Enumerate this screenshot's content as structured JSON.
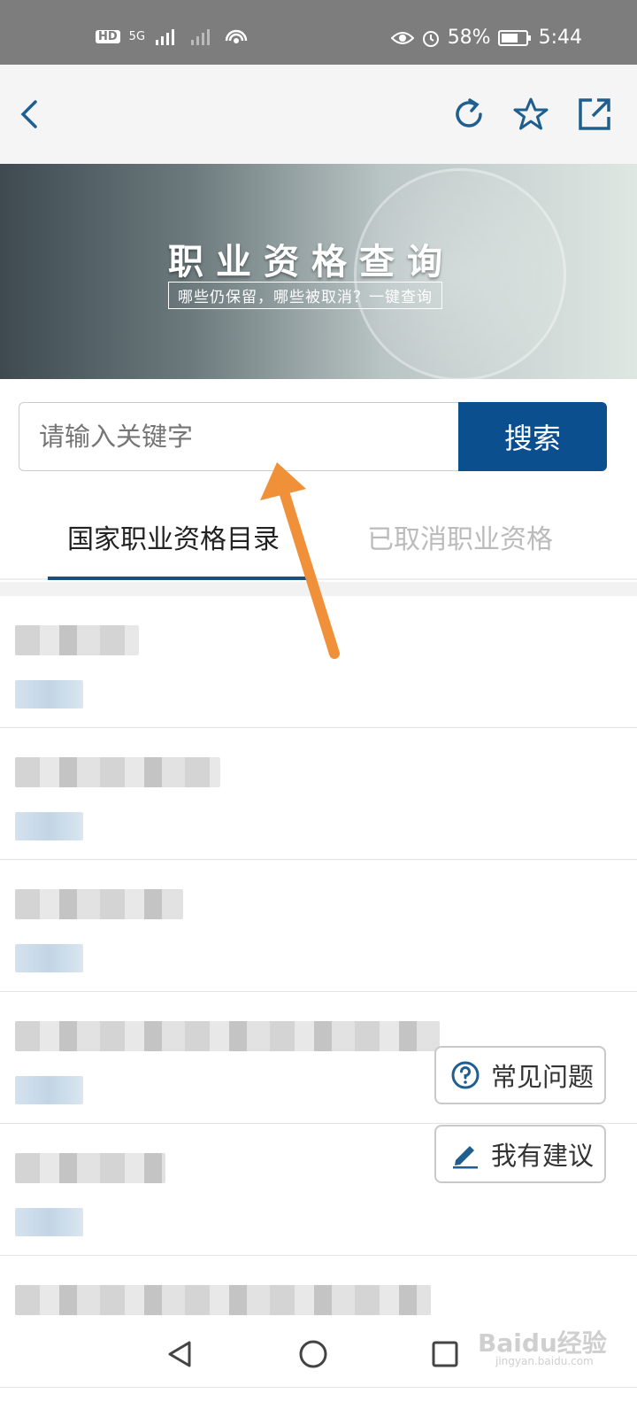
{
  "status_bar": {
    "left": [
      "HD",
      "5G",
      "Wi-Fi"
    ],
    "battery": "58%",
    "time": "5:44"
  },
  "toolbar": {
    "back_icon": "chevron-left-icon",
    "refresh_icon": "refresh-icon",
    "favorite_icon": "star-icon",
    "share_icon": "external-link-icon"
  },
  "banner": {
    "title": "职业资格查询",
    "subtitle": "哪些仍保留，哪些被取消？一键查询"
  },
  "search": {
    "placeholder": "请输入关键字",
    "button_label": "搜索"
  },
  "tabs": [
    {
      "label": "国家职业资格目录",
      "active": true
    },
    {
      "label": "已取消职业资格",
      "active": false
    }
  ],
  "floating_actions": {
    "faq_label": "常见问题",
    "suggest_label": "我有建议"
  },
  "watermark": {
    "text": "Baidu经验",
    "url": "jingyan.baidu.com"
  },
  "colors": {
    "accent": "#0b4f8f",
    "tab_underline": "#1e4f7a",
    "annotation_arrow": "#f0913a"
  }
}
